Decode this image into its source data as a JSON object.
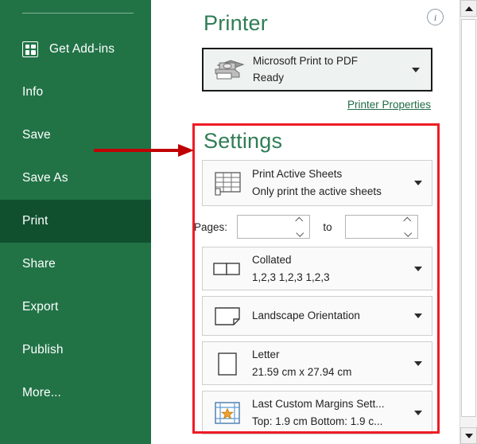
{
  "sidebar": {
    "background_color": "#217346",
    "selected_color": "#10502f",
    "items": [
      {
        "label": "Get Add-ins",
        "icon": "addins-grid-icon",
        "selected": false
      },
      {
        "label": "Info",
        "icon": "",
        "selected": false
      },
      {
        "label": "Save",
        "icon": "",
        "selected": false
      },
      {
        "label": "Save As",
        "icon": "",
        "selected": false
      },
      {
        "label": "Print",
        "icon": "",
        "selected": true
      },
      {
        "label": "Share",
        "icon": "",
        "selected": false
      },
      {
        "label": "Export",
        "icon": "",
        "selected": false
      },
      {
        "label": "Publish",
        "icon": "",
        "selected": false
      },
      {
        "label": "More...",
        "icon": "",
        "selected": false
      }
    ]
  },
  "annotation": {
    "arrow_color": "#c00000",
    "highlight_box_color": "#ee1c25"
  },
  "printer": {
    "title": "Printer",
    "info_icon": "info-circle-icon",
    "selected_printer": "Microsoft Print to PDF",
    "status": "Ready",
    "properties_link": "Printer Properties",
    "printer_icon": "printer-icon"
  },
  "settings": {
    "title": "Settings",
    "accent_color": "#2f7d54",
    "rows": [
      {
        "icon": "worksheet-grid-icon",
        "primary": "Print Active Sheets",
        "secondary": "Only print the active sheets"
      },
      {
        "icon": "collate-pages-icon",
        "primary": "Collated",
        "secondary": "1,2,3   1,2,3   1,2,3"
      },
      {
        "icon": "landscape-page-icon",
        "primary": "Landscape Orientation",
        "secondary": ""
      },
      {
        "icon": "paper-size-icon",
        "primary": "Letter",
        "secondary": "21.59 cm x 27.94 cm"
      },
      {
        "icon": "margins-star-icon",
        "primary": "Last Custom Margins Sett...",
        "secondary": "Top: 1.9 cm Bottom: 1.9 c..."
      }
    ],
    "pages": {
      "label": "Pages:",
      "from_value": "",
      "to_label": "to",
      "to_value": ""
    }
  },
  "scrollbar": {
    "up_arrow": "scroll-up-icon",
    "down_arrow": "scroll-down-icon"
  }
}
